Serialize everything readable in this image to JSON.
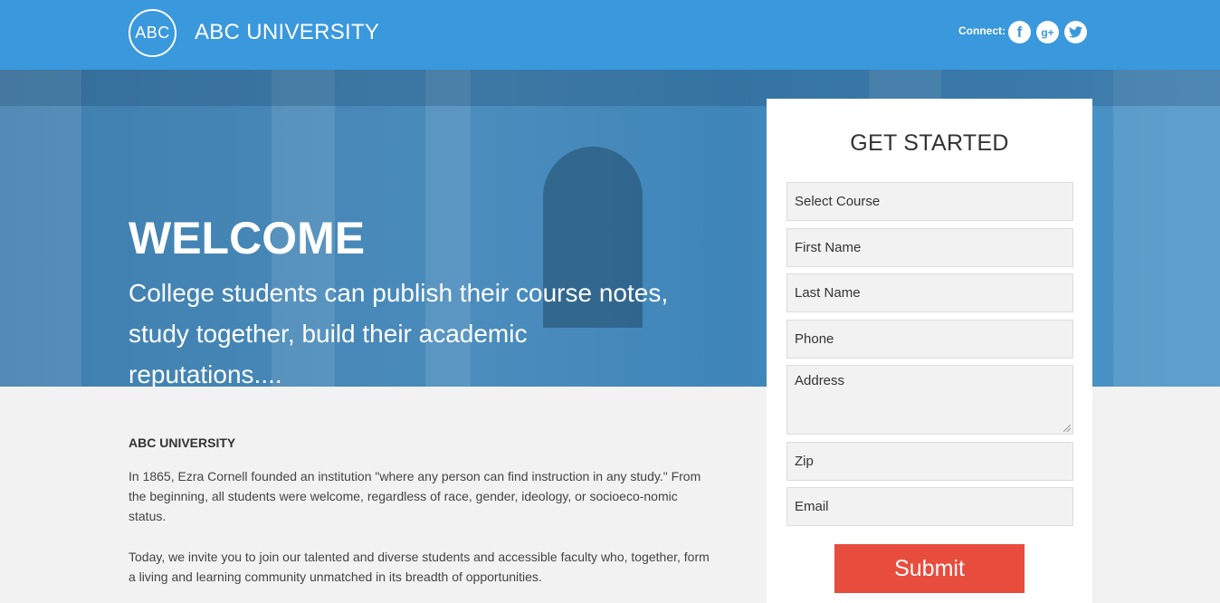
{
  "header": {
    "logo_text": "ABC",
    "brand": "ABC UNIVERSITY",
    "connect_label": "Connect:",
    "social": [
      {
        "icon": "facebook-icon",
        "glyph": "f"
      },
      {
        "icon": "google-plus-icon",
        "glyph": "g+"
      },
      {
        "icon": "twitter-icon",
        "glyph": "🐦"
      }
    ]
  },
  "hero": {
    "title": "WELCOME",
    "subtitle": "College students can publish their course notes, study together, build their academic reputations...."
  },
  "about": {
    "title": "ABC UNIVERSITY",
    "paragraph1": "In 1865, Ezra Cornell founded an institution \"where any person can find instruction in any study.\" From the beginning, all students were welcome, regardless of race, gender, ideology, or socioeco-nomic status.",
    "paragraph2": "Today, we invite you to join our talented and diverse students and accessible faculty who, together, form a living and learning community unmatched in its breadth of opportunities."
  },
  "form": {
    "title": "GET STARTED",
    "select_course": "Select Course",
    "first_name": "First Name",
    "last_name": "Last Name",
    "phone": "Phone",
    "address": "Address",
    "zip": "Zip",
    "email": "Email",
    "submit_label": "Submit"
  },
  "colors": {
    "header": "#3a98dc",
    "submit": "#e84c3d",
    "page_bg": "#f2f2f2"
  }
}
